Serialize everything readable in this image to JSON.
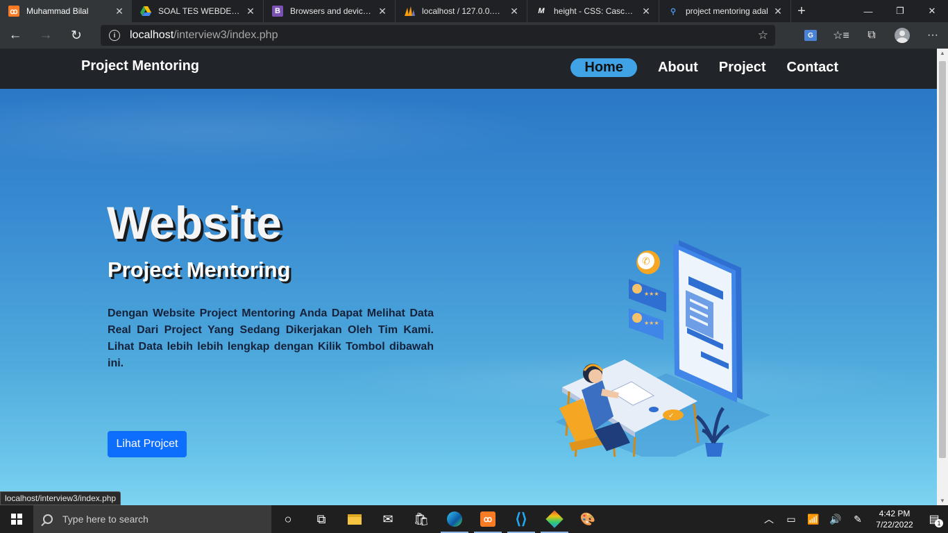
{
  "browser": {
    "tabs": [
      {
        "label": "Muhammad Bilal",
        "favicon": "xampp-icon",
        "favicon_color": "#fb7a24",
        "active": true
      },
      {
        "label": "SOAL TES WEBDEV DIG",
        "favicon": "google-drive-icon",
        "favicon_color": "#34a853",
        "active": false
      },
      {
        "label": "Browsers and devices ·",
        "favicon": "bootstrap-icon",
        "favicon_color": "#7952b3",
        "active": false
      },
      {
        "label": "localhost / 127.0.0.1 / in",
        "favicon": "phpmyadmin-icon",
        "favicon_color": "#f89c0e",
        "active": false
      },
      {
        "label": "height - CSS: Cascading",
        "favicon": "mdn-icon",
        "favicon_color": "#ffffff",
        "active": false
      },
      {
        "label": "project mentoring adal",
        "favicon": "search-icon",
        "favicon_color": "#4a90e2",
        "active": false
      }
    ],
    "new_tab": "+",
    "url_host": "localhost",
    "url_path": "/interview3/index.php",
    "status_url": "localhost/interview3/index.php"
  },
  "site": {
    "brand": "Project Mentoring",
    "nav": [
      {
        "label": "Home",
        "active": true
      },
      {
        "label": "About",
        "active": false
      },
      {
        "label": "Project",
        "active": false
      },
      {
        "label": "Contact",
        "active": false
      }
    ],
    "hero": {
      "title": "Website",
      "subtitle": "Project Mentoring",
      "description": "Dengan Website Project Mentoring Anda Dapat Melihat Data Real Dari Project Yang Sedang Dikerjakan Oleh Tim Kami. Lihat Data lebih lebih lengkap dengan Kilik Tombol dibawah ini.",
      "button": "Lihat Projcet"
    },
    "colors": {
      "navbar": "#212529",
      "nav_active_pill": "#3fa3e6",
      "button": "#0d6efd"
    }
  },
  "taskbar": {
    "search_placeholder": "Type here to search",
    "time": "4:42 PM",
    "date": "7/22/2022",
    "notifications": "1"
  }
}
